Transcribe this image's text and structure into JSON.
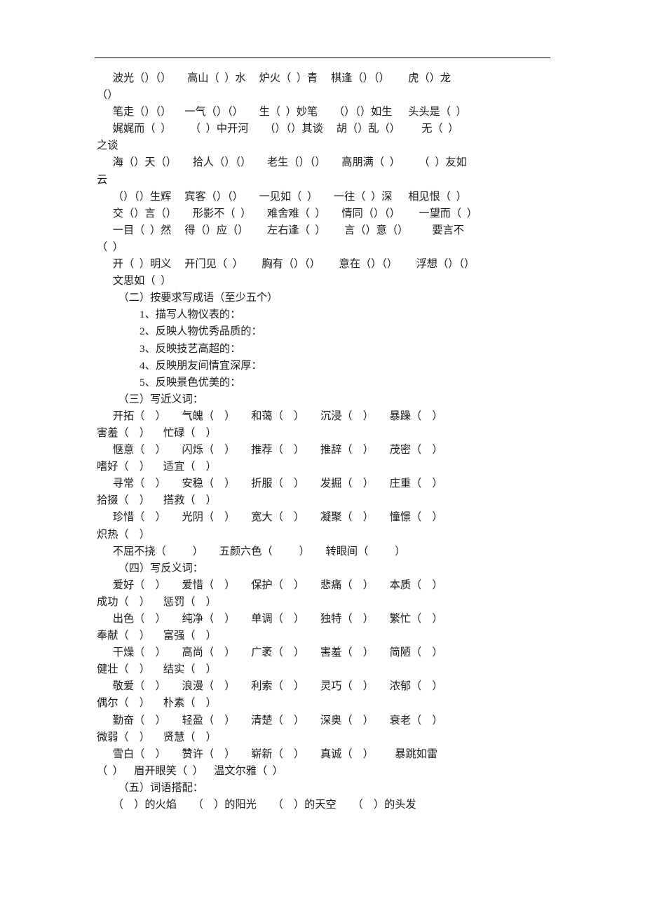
{
  "document": {
    "language": "zh-CN",
    "has_top_rule": true
  },
  "idioms": {
    "lines": [
      "      波光（）（）      高山（  ）水     炉火（  ）青     棋逢（）（）       虎（）龙",
      "（）",
      "      笔走（）（）     一气（）（）      生（  ）妙笔      （）（）如生      头头是（  ）",
      "      娓娓而（  ）       （  ）中开河      （）（）其谈     胡（）乱（）        无（  ）",
      "之谈",
      "      海（）天（）      拾人（）（）      老生（）（）      高朋满（  ）       （  ）友如",
      "云",
      "      （）（）生辉     宾客（）（）      一见如（  ）      一往（  ）深      相见恨（  ）",
      "      交（）言（）      形影不（  ）      难舍难（  ）      情同（）（）       一望而（  ）",
      "      一目（  ）然     得（）应（）       左右逢（  ）       言（）意（）         要言不",
      "（  ）",
      "      开（  ）明义     开门见（  ）       胸有（）（）       意在（）（）       浮想（）（）",
      "      文思如（  ）"
    ]
  },
  "section_two": {
    "heading": "（二）按要求写成语（至少五个）",
    "items": [
      "1、描写人物仪表的：",
      "2、反映人物优秀品质的：",
      "3、反映技艺高超的：",
      "4、反映朋友间情宜深厚：",
      "5、反映景色优美的："
    ]
  },
  "section_three": {
    "heading": "（三）写近义词：",
    "lines": [
      "      开拓（    ）      气魄（    ）      和蔼（    ）      沉浸（    ）      暴躁（    ）",
      "害羞（    ）     忙碌（    ）",
      "      惬意（    ）      闪烁（    ）      推荐（    ）      推辞（    ）      茂密（    ）",
      "嗜好（    ）     适宜（    ）",
      "      寻常（    ）      安稳（    ）      折服（    ）      发掘（    ）      庄重（    ）",
      "拾掇（    ）     搭救（    ）",
      "      珍惜（    ）      光阴（    ）      宽大（    ）      凝聚（    ）      憧憬（    ）",
      "炽热（    ）",
      "      不屈不挠（          ）      五颜六色（          ）      转眼间（          ）"
    ]
  },
  "section_four": {
    "heading": "（四）写反义词：",
    "lines": [
      "      爱好（    ）      爱惜（    ）      保护（    ）      悲痛（    ）      本质（    ）",
      "成功（    ）     惩罚（    ）",
      "      出色（    ）      纯净（    ）      单调（    ）      独特（    ）      繁忙（    ）",
      "奉献（    ）     富强（    ）",
      "      干燥（    ）      高尚（    ）      广袤（    ）      害羞（    ）      简陋（    ）",
      "健壮（    ）     结实（    ）",
      "      敬爱（    ）      浪漫（    ）      利索（    ）      灵巧（    ）      浓郁（    ）",
      "偶尔（    ）     朴素（    ）",
      "      勤奋（    ）      轻盈（    ）      清楚（    ）      深奥（    ）      衰老（    ）",
      "微弱（    ）     贤慧（    ）",
      "      雪白（    ）      赞许（    ）      崭新（    ）      真诚（    ）        暴跳如雷",
      "（  ）    眉开眼笑（  ）    温文尔雅（  ）"
    ]
  },
  "section_five": {
    "heading": "（五）词语搭配：",
    "lines": [
      "      （    ）的火焰      （    ）的阳光      （    ）的天空      （    ）的头发"
    ]
  }
}
